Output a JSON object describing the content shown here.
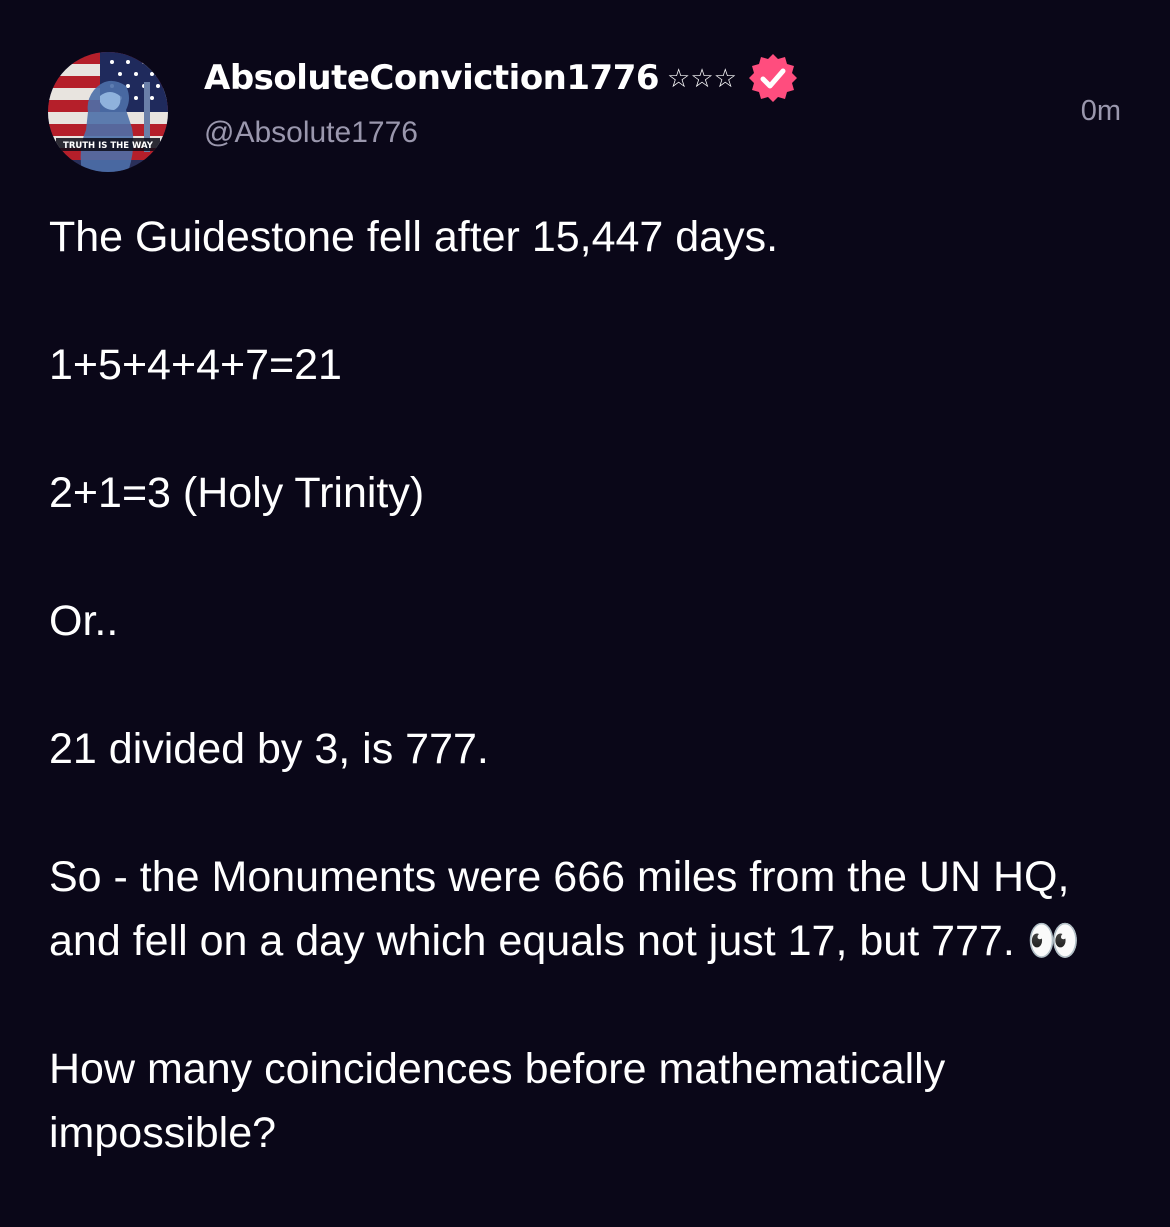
{
  "author": {
    "display_name": "Å̵̡b̶̡s̡o̸l̸̡u̸̡t̶̡e̡C̸̡o̸n̡v̡ì̸ç̸t̶̡i̡o̸n̡1776",
    "display_name_plain": "AbsoluteConviction1776",
    "stars": "☆☆☆",
    "handle": "@Absolute1776",
    "avatar_icon": "avatar-flag-icon",
    "avatar_caption": "TRUTH IS THE WAY",
    "verified_icon": "verified-badge-icon",
    "verified_color": "#ff4d7e"
  },
  "timestamp": "0m",
  "post": {
    "lines": [
      "The Guidestone fell after 15,447 days.",
      "1+5+4+4+7=21",
      "2+1=3 (Holy Trinity)",
      "Or..",
      "21 divided by 3, is 777.",
      "So - the Monuments were 666 miles from the UN HQ, and fell on a day which equals not just 17, but 777. 👀",
      "How many coincidences before mathematically impossible?"
    ]
  },
  "colors": {
    "background": "#0a0718",
    "text": "#ffffff",
    "secondary_text": "#9a97ad"
  }
}
